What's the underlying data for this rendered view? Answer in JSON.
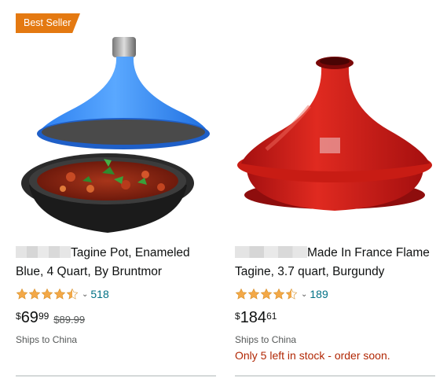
{
  "badge": {
    "label": "Best Seller",
    "color": "#e47911"
  },
  "products": [
    {
      "image_icon": "blue-tagine-icon",
      "title_blur_icon": "redacted-text",
      "title": "Tagine Pot, Enameled Blue, 4 Quart, By Bruntmor",
      "rating": 4.5,
      "review_count": "518",
      "price_currency": "$",
      "price_whole": "69",
      "price_fraction": "99",
      "list_price": "$89.99",
      "shipping": "Ships to China"
    },
    {
      "image_icon": "red-tagine-icon",
      "title_blur_icon": "redacted-text",
      "title": "Made In France Flame Tagine, 3.7 quart, Burgundy",
      "rating": 4.5,
      "review_count": "189",
      "price_currency": "$",
      "price_whole": "184",
      "price_fraction": "61",
      "shipping": "Ships to China",
      "stock_notice": "Only 5 left in stock - order soon."
    }
  ],
  "colors": {
    "star": "#f3a847",
    "link": "#007185",
    "stock_warning": "#b12704"
  }
}
